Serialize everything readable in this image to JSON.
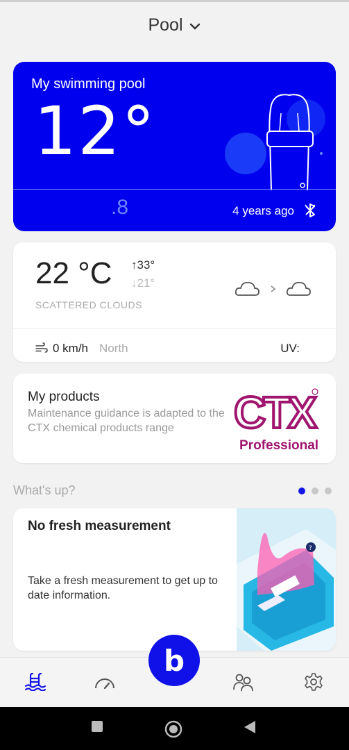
{
  "header": {
    "title": "Pool",
    "chevron_icon": "chevron-down-icon"
  },
  "pool_card": {
    "name": "My swimming pool",
    "temp_main": "12°",
    "temp_decimal": ".8",
    "last_update": "4 years ago",
    "bt_icon": "bluetooth-icon",
    "accent": "#0000ee"
  },
  "weather": {
    "temp": "22 °C",
    "high": "33°",
    "low": "21°",
    "description": "SCATTERED CLOUDS",
    "wind_speed": "0 km/h",
    "wind_direction": "North",
    "uv_label": "UV:"
  },
  "products": {
    "title": "My products",
    "description": "Maintenance guidance is adapted to the CTX chemical products range",
    "logo_text": "CTX",
    "logo_subtext": "Professional"
  },
  "whats_up": {
    "label": "What's up?",
    "active_index": 0,
    "page_count": 3
  },
  "news": {
    "title": "No fresh measurement",
    "body": "Take a fresh measurement to get up to date information."
  },
  "tabs": [
    "pool-icon",
    "gauge-icon",
    "brand-b-icon",
    "people-icon",
    "settings-icon"
  ],
  "center_button": {
    "label": "b"
  },
  "colors": {
    "brand": "#1010e8",
    "background": "#f2f2f2"
  }
}
